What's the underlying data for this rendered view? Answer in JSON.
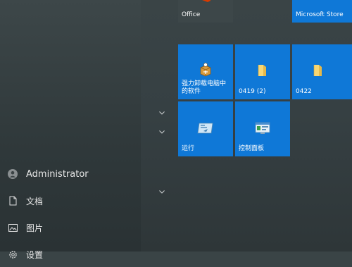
{
  "user": {
    "name": "Administrator"
  },
  "left_nav": {
    "items": [
      {
        "label": "文档",
        "icon": "document-icon"
      },
      {
        "label": "图片",
        "icon": "picture-icon"
      },
      {
        "label": "设置",
        "icon": "settings-icon"
      }
    ]
  },
  "tiles": {
    "office": {
      "label": "Office",
      "icon": "office-icon"
    },
    "store": {
      "label": "Microsoft Store",
      "icon": "store-icon"
    },
    "uninstall": {
      "label": "强力卸载电脑中的软件",
      "icon": "uninstall-box-icon"
    },
    "folder1": {
      "label": "0419 (2)",
      "icon": "folder-icon"
    },
    "folder2": {
      "label": "0422",
      "icon": "folder-icon"
    },
    "run": {
      "label": "运行",
      "icon": "run-icon"
    },
    "control": {
      "label": "控制面板",
      "icon": "control-panel-icon"
    }
  },
  "colors": {
    "tile_blue": "#0f78d7",
    "background": "#364043"
  }
}
